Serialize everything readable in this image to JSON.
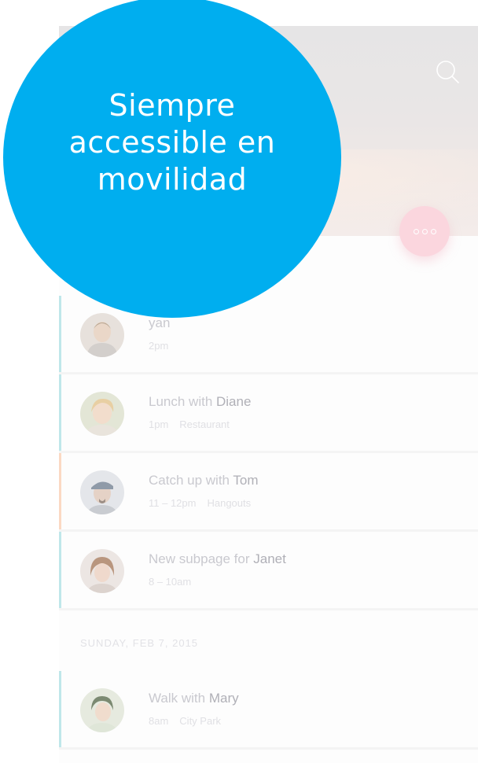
{
  "promo": {
    "line1": "Siempre",
    "line2": "accessible en",
    "line3": "movilidad"
  },
  "header": {
    "search_icon": "search-icon",
    "menu_icon": "more-dots-icon"
  },
  "colors": {
    "promo_bubble": "#00aeef",
    "fab": "#fbd6de",
    "event_bar_teal": "#bfe7ea",
    "event_bar_orange": "#fbd9c3"
  },
  "events": [
    {
      "title": "yan",
      "name": "",
      "time": "2pm",
      "place": ""
    },
    {
      "title": "Lunch with ",
      "name": "Diane",
      "time": "1pm",
      "place": "Restaurant"
    },
    {
      "title": "Catch up with ",
      "name": "Tom",
      "time": "11 – 12pm",
      "place": "Hangouts"
    },
    {
      "title": "New subpage for ",
      "name": "Janet",
      "time": "8 – 10am",
      "place": ""
    }
  ],
  "section": {
    "label": "SUNDAY, FEB 7, 2015"
  },
  "events2": [
    {
      "title": "Walk with ",
      "name": "Mary",
      "time": "8am",
      "place": "City Park"
    }
  ]
}
